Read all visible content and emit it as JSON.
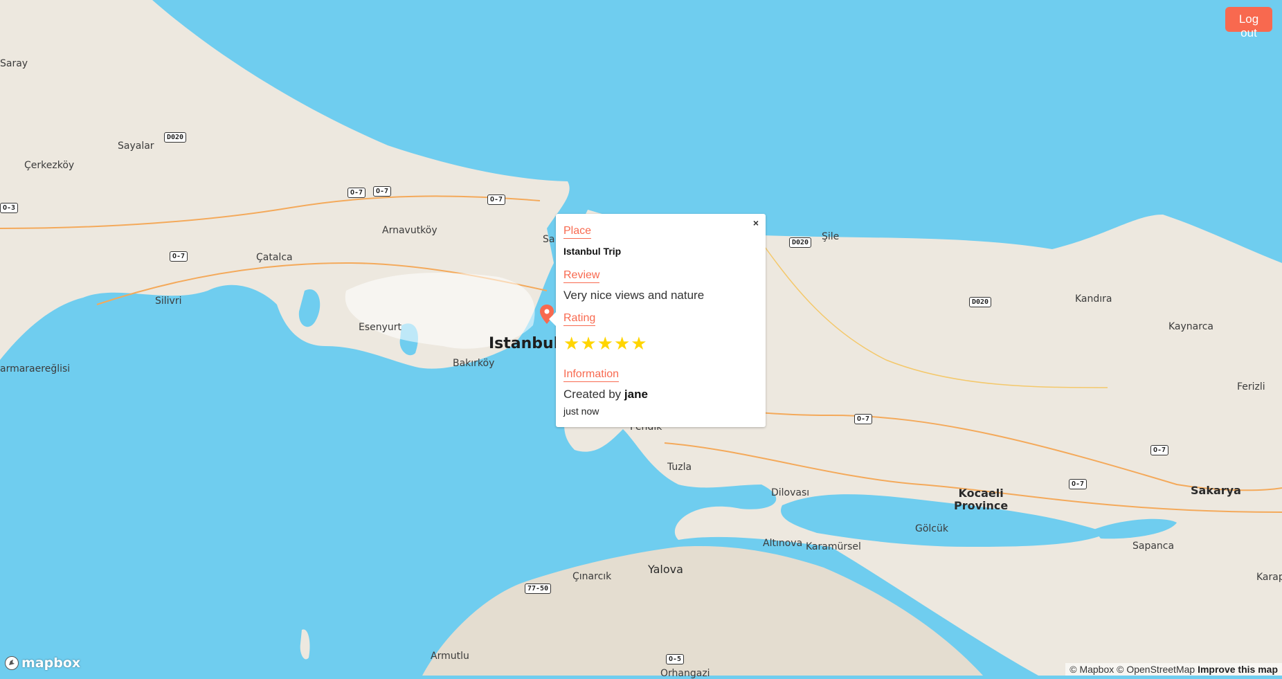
{
  "header": {
    "logout_label": "Log out"
  },
  "map": {
    "labels": {
      "saray": "Saray",
      "sayalar": "Sayalar",
      "cerkezkoy": "Çerkezköy",
      "arnavutkoy": "Arnavutköy",
      "catalca": "Çatalca",
      "silivri": "Silivri",
      "esenyurt": "Esenyurt",
      "istanbul": "Istanbul",
      "bakirkoy": "Bakırköy",
      "marmaraereglisi": "armaraereğlisi",
      "sile": "Şile",
      "kandira": "Kandıra",
      "kaynarca": "Kaynarca",
      "ferizli": "Ferizli",
      "pendik": "Pendik",
      "tuzla": "Tuzla",
      "dilovasi": "Dilovası",
      "kocaeli": "Kocaeli",
      "province": "Province",
      "sakarya": "Sakarya",
      "golcuk": "Gölcük",
      "sapanca": "Sapanca",
      "altinova": "Altınova",
      "karamursel": "Karamürsel",
      "yalova": "Yalova",
      "cinarcik": "Çınarcık",
      "armutlu": "Armutlu",
      "orhangazi": "Orhangazi",
      "karap": "Karap",
      "sariyer": "Sa"
    },
    "shields": {
      "d020_a": "D020",
      "o3": "O-3",
      "o7_a": "O-7",
      "o7_b": "O-7",
      "o7_c": "O-7",
      "o7_d": "O-7",
      "d020_b": "D020",
      "d020_c": "D020",
      "o7_e": "O-7",
      "o7_f": "O-7",
      "o7_g": "O-7",
      "e7750": "77-50",
      "o5": "O-5"
    },
    "colors": {
      "water": "#6fcdef",
      "land": "#ede8df",
      "marker": "#f8694f",
      "accent": "#f8694f",
      "star": "#ffd500"
    }
  },
  "marker": {
    "icon": "map-pin-icon"
  },
  "popup": {
    "close_label": "×",
    "place_label": "Place",
    "place_value": "Istanbul Trip",
    "review_label": "Review",
    "review_value": "Very nice views and nature",
    "rating_label": "Rating",
    "rating_value": 5,
    "rating_max": 5,
    "info_label": "Information",
    "created_prefix": "Created by ",
    "created_user": "jane",
    "created_time": "just now"
  },
  "footer": {
    "logo_text": "mapbox",
    "attribution_mapbox": "© Mapbox",
    "attribution_osm": "© OpenStreetMap",
    "improve_link": "Improve this map"
  }
}
